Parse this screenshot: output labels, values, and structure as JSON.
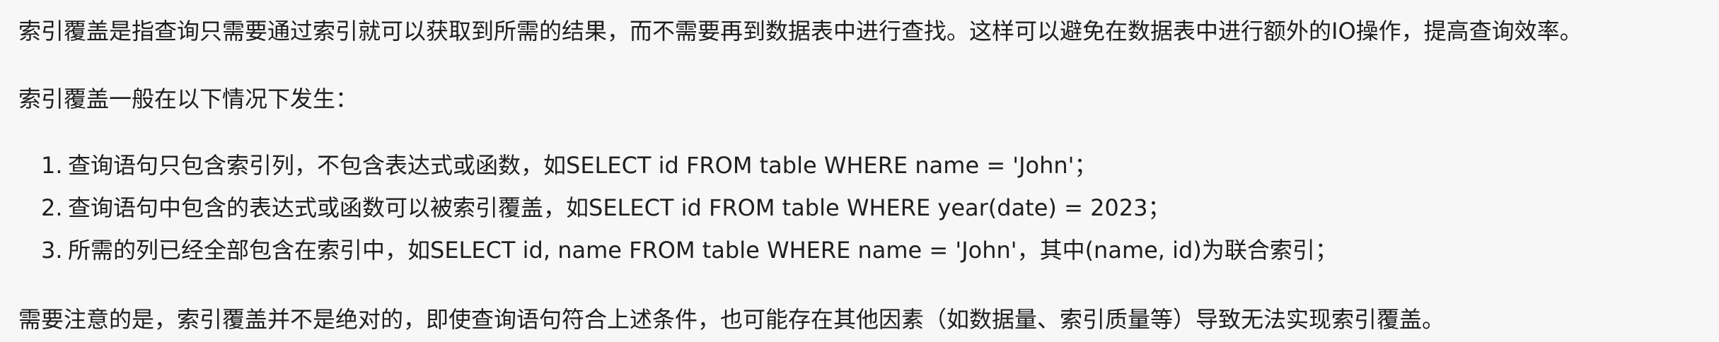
{
  "paragraphs": {
    "intro": "索引覆盖是指查询只需要通过索引就可以获取到所需的结果，而不需要再到数据表中进行查找。这样可以避免在数据表中进行额外的IO操作，提高查询效率。",
    "lead": "索引覆盖一般在以下情况下发生：",
    "note": "需要注意的是，索引覆盖并不是绝对的，即使查询语句符合上述条件，也可能存在其他因素（如数据量、索引质量等）导致无法实现索引覆盖。"
  },
  "conditions": [
    {
      "num": "1.",
      "text": "查询语句只包含索引列，不包含表达式或函数，如SELECT id FROM table WHERE name = 'John'；"
    },
    {
      "num": "2.",
      "text": "查询语句中包含的表达式或函数可以被索引覆盖，如SELECT id FROM table WHERE year(date) = 2023；"
    },
    {
      "num": "3.",
      "text": "所需的列已经全部包含在索引中，如SELECT id, name FROM table WHERE name = 'John'，其中(name, id)为联合索引；"
    }
  ]
}
